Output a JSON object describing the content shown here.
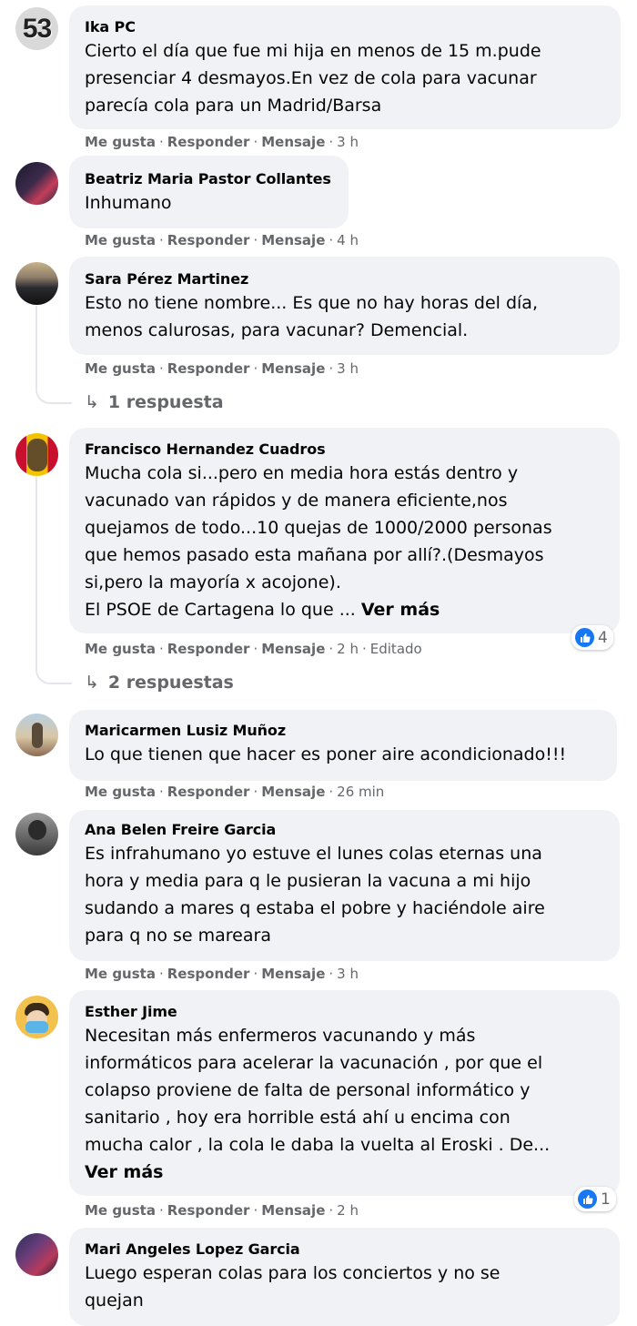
{
  "actions": {
    "like": "Me gusta",
    "reply": "Responder",
    "message": "Mensaje",
    "sep": "·"
  },
  "see_more": "Ver más",
  "comments": [
    {
      "author": "Ika PC",
      "avatar_text": "53",
      "text": "Cierto el día que fue mi hija en menos de 15 m.pude\npresenciar 4 desmayos.En vez de cola para vacunar\nparecía cola para un Madrid/Barsa",
      "time": "3 h"
    },
    {
      "author": "Beatriz Maria Pastor Collantes",
      "text": "Inhumano",
      "time": "4 h"
    },
    {
      "author": "Sara Pérez Martinez",
      "text": "Esto no tiene nombre... Es que no hay horas del día,\nmenos calurosas, para vacunar? Demencial.",
      "time": "3 h",
      "replies": "1 respuesta"
    },
    {
      "author": "Francisco Hernandez Cuadros",
      "text": "Mucha cola si...pero en media hora estás dentro y\nvacunado van rápidos y de manera eficiente,nos\nquejamos de todo...10 quejas de 1000/2000 personas\nque hemos pasado esta mañana por allí?.(Desmayos\nsi,pero la mayoría x acojone).\nEl PSOE de Cartagena lo que ...",
      "time": "2 h",
      "edited": "Editado",
      "reactions": "4",
      "replies": "2 respuestas"
    },
    {
      "author": "Maricarmen Lusiz Muñoz",
      "text": "Lo que tienen que hacer es poner aire acondicionado!!!",
      "time": "26 min"
    },
    {
      "author": "Ana Belen Freire Garcia",
      "text": "Es infrahumano yo estuve el lunes colas eternas una\nhora y media para q le pusieran la vacuna a mi hijo\nsudando a mares q estaba el pobre y haciéndole aire\npara q no se mareara",
      "time": "3 h"
    },
    {
      "author": "Esther Jime",
      "text": "Necesitan más enfermeros vacunando y más\ninformáticos para acelerar la vacunación , por que el\ncolapso proviene de falta de personal informático y\nsanitario , hoy era horrible está ahí u encima con\nmucha calor , la cola le daba la vuelta al Eroski . De...",
      "time": "2 h",
      "reactions": "1"
    },
    {
      "author": "Mari Angeles Lopez Garcia",
      "text": "Luego esperan colas para los conciertos y no se\nquejan"
    }
  ]
}
